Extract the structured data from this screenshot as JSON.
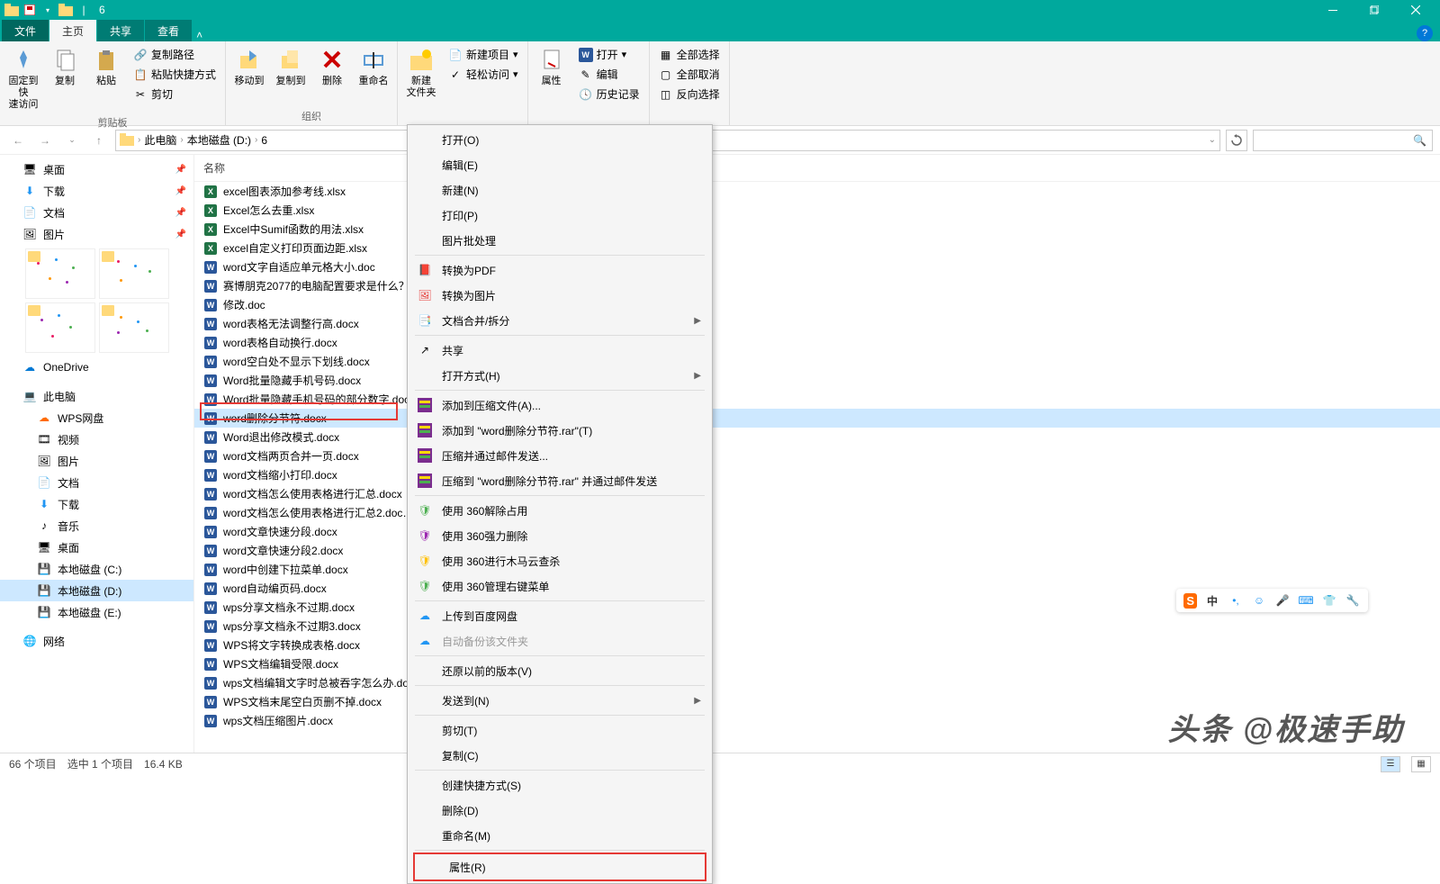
{
  "window": {
    "title": "6"
  },
  "tabs": {
    "file": "文件",
    "home": "主页",
    "share": "共享",
    "view": "查看"
  },
  "ribbon": {
    "pin": "固定到快\n速访问",
    "copy": "复制",
    "paste": "粘贴",
    "copy_path": "复制路径",
    "paste_shortcut": "粘贴快捷方式",
    "cut": "剪切",
    "clipboard_group": "剪贴板",
    "move_to": "移动到",
    "copy_to": "复制到",
    "delete": "删除",
    "rename": "重命名",
    "organize_group": "组织",
    "new_folder": "新建\n文件夹",
    "new_item": "新建项目",
    "easy_access": "轻松访问",
    "properties": "属性",
    "open": "打开",
    "edit": "编辑",
    "history": "历史记录",
    "select_all": "全部选择",
    "select_none": "全部取消",
    "invert": "反向选择"
  },
  "breadcrumb": {
    "this_pc": "此电脑",
    "drive": "本地磁盘 (D:)",
    "folder": "6"
  },
  "nav": {
    "desktop": "桌面",
    "downloads": "下载",
    "documents": "文档",
    "pictures": "图片",
    "onedrive": "OneDrive",
    "this_pc": "此电脑",
    "wps": "WPS网盘",
    "videos": "视频",
    "pictures2": "图片",
    "documents2": "文档",
    "downloads2": "下载",
    "music": "音乐",
    "desktop2": "桌面",
    "drive_c": "本地磁盘 (C:)",
    "drive_d": "本地磁盘 (D:)",
    "drive_e": "本地磁盘 (E:)",
    "network": "网络"
  },
  "file_header": "名称",
  "files": [
    "excel图表添加参考线.xlsx",
    "Excel怎么去重.xlsx",
    "Excel中Sumif函数的用法.xlsx",
    "excel自定义打印页面边距.xlsx",
    "word文字自适应单元格大小.doc",
    "赛博朋克2077的电脑配置要求是什么？.…",
    "修改.doc",
    "word表格无法调整行高.docx",
    "word表格自动换行.docx",
    "word空白处不显示下划线.docx",
    "Word批量隐藏手机号码.docx",
    "Word批量隐藏手机号码的部分数字.doc…",
    "word删除分节符.docx",
    "Word退出修改模式.docx",
    "word文档两页合并一页.docx",
    "word文档缩小打印.docx",
    "word文档怎么使用表格进行汇总.docx",
    "word文档怎么使用表格进行汇总2.doc…",
    "word文章快速分段.docx",
    "word文章快速分段2.docx",
    "word中创建下拉菜单.docx",
    "word自动编页码.docx",
    "wps分享文档永不过期.docx",
    "wps分享文档永不过期3.docx",
    "WPS将文字转换成表格.docx",
    "WPS文档编辑受限.docx",
    "wps文档编辑文字时总被吞字怎么办.do…",
    "WPS文档末尾空白页删不掉.docx",
    "wps文档压缩图片.docx"
  ],
  "selected_index": 12,
  "context_menu": {
    "open": "打开(O)",
    "edit": "编辑(E)",
    "new": "新建(N)",
    "print": "打印(P)",
    "batch_img": "图片批处理",
    "to_pdf": "转换为PDF",
    "to_img": "转换为图片",
    "merge_split": "文档合并/拆分",
    "share": "共享",
    "open_with": "打开方式(H)",
    "add_archive": "添加到压缩文件(A)...",
    "add_rar": "添加到 \"word删除分节符.rar\"(T)",
    "compress_mail": "压缩并通过邮件发送...",
    "compress_rar_mail": "压缩到 \"word删除分节符.rar\" 并通过邮件发送",
    "unlock_360": "使用 360解除占用",
    "force_del_360": "使用 360强力删除",
    "trojan_360": "使用 360进行木马云查杀",
    "menu_360": "使用 360管理右键菜单",
    "upload_baidu": "上传到百度网盘",
    "auto_backup": "自动备份该文件夹",
    "restore": "还原以前的版本(V)",
    "send_to": "发送到(N)",
    "cut": "剪切(T)",
    "copy": "复制(C)",
    "create_shortcut": "创建快捷方式(S)",
    "delete": "删除(D)",
    "rename": "重命名(M)",
    "properties": "属性(R)"
  },
  "statusbar": {
    "items": "66 个项目",
    "selected": "选中 1 个项目",
    "size": "16.4 KB"
  },
  "floating": {
    "lang": "中"
  },
  "watermark": "头条 @极速手助"
}
